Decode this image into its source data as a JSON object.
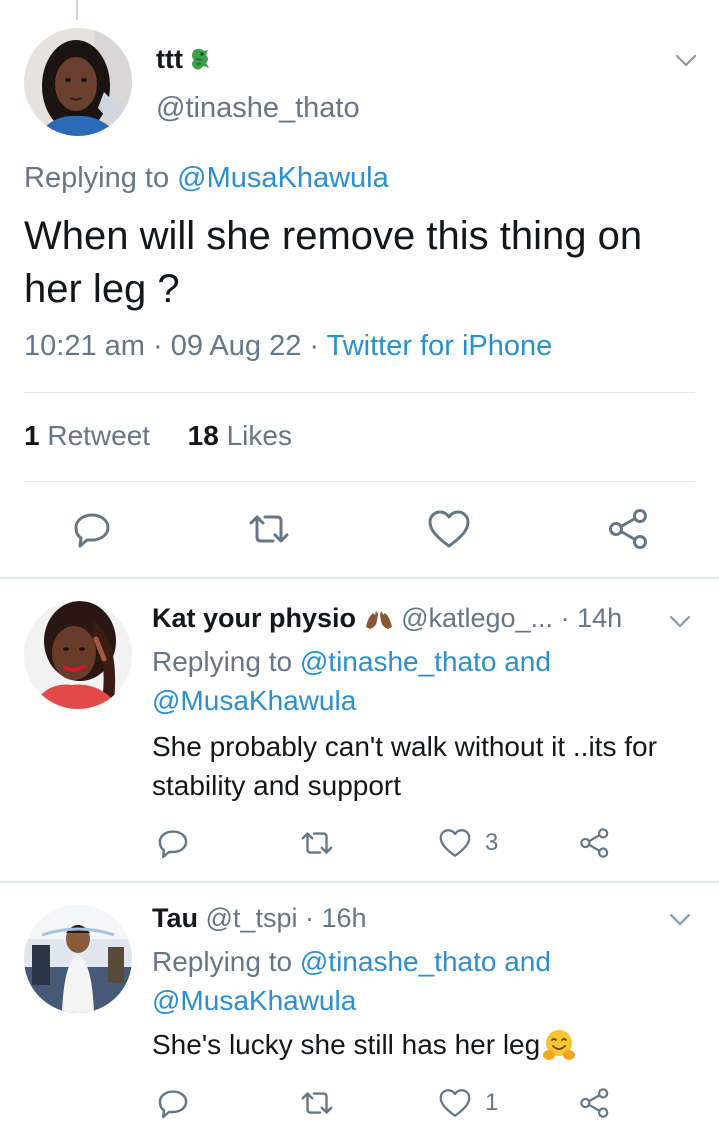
{
  "main_tweet": {
    "name": "ttt",
    "name_emoji_icon": "dragon-emoji-icon",
    "handle": "@tinashe_thato",
    "replying_prefix": "Replying to ",
    "replying_to": "@MusaKhawula",
    "text": "When will she remove this thing on her leg ?",
    "time": "10:21 am",
    "dot1": " · ",
    "date": "09 Aug 22",
    "dot2": " · ",
    "source": "Twitter for iPhone",
    "retweet_count": "1",
    "retweet_label": " Retweet",
    "likes_count": "18",
    "likes_label": " Likes"
  },
  "replies": [
    {
      "name": "Kat your physio",
      "name_emoji_icon": "raising-hands-emoji-icon",
      "handle": "@katlego_...",
      "dot": " · ",
      "time": "14h",
      "replying_prefix": "Replying to ",
      "replying_to_1": "@tinashe_thato",
      "replying_and": " and",
      "replying_to_2": "@MusaKhawula",
      "text": "She probably can't walk without it ..its for stability and support",
      "like_count": "3"
    },
    {
      "name": "Tau",
      "handle": "@t_tspi",
      "dot": " · ",
      "time": "16h",
      "replying_prefix": "Replying to ",
      "replying_to_1": "@tinashe_thato",
      "replying_and": " and",
      "replying_to_2": "@MusaKhawula",
      "text": "She's lucky she still has her leg",
      "text_emoji_icon": "hugging-face-emoji-icon",
      "like_count": "1"
    }
  ],
  "colors": {
    "link": "#2b8fd0",
    "secondary_text": "#657786",
    "primary_text": "#14171a",
    "divider": "#e1e8ed"
  }
}
